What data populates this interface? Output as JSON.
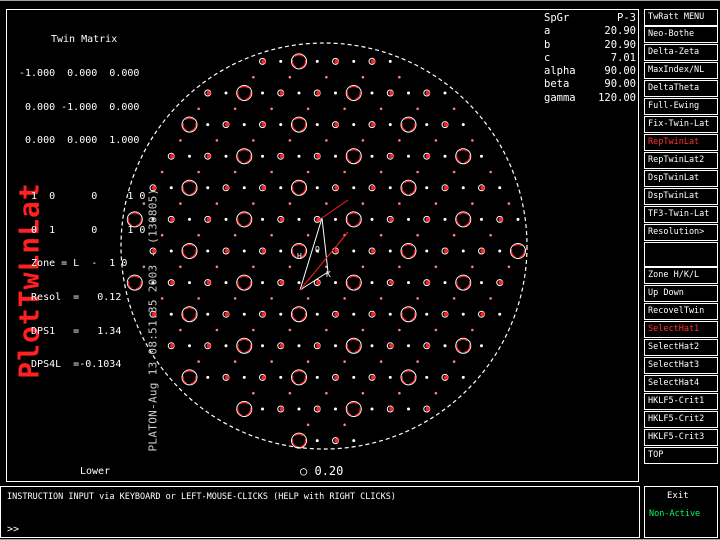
{
  "header": {
    "vertical_title": "PLATON-Aug 13 08:51:35 2003 - (130805)",
    "program_name": "PlotTwLnLat"
  },
  "twin_matrix": {
    "title": "Twin Matrix",
    "rows": [
      "-1.000  0.000  0.000",
      " 0.000 -1.000  0.000",
      " 0.000  0.000  1.000",
      "",
      "  1  0      0     1 0",
      "  0  1      0     1 0",
      "  Zone = L  -  1 0",
      "  Resol  =   0.12",
      "  DPS1   =   1.34",
      "  DPS4L  =-0.1034"
    ]
  },
  "cell_params": [
    {
      "label": "SpGr",
      "value": "P-3"
    },
    {
      "label": "a",
      "value": "20.90"
    },
    {
      "label": "b",
      "value": "20.90"
    },
    {
      "label": "c",
      "value": "7.01"
    },
    {
      "label": "alpha",
      "value": "90.00"
    },
    {
      "label": "beta",
      "value": "90.00"
    },
    {
      "label": "gamma",
      "value": "120.00"
    }
  ],
  "plot": {
    "lower_label": "Lower",
    "scale_label": "0.20",
    "axis_h": "H",
    "axis_k": "K",
    "axis_q": "Q"
  },
  "menu": {
    "items": [
      {
        "label": "TwRatt MENU",
        "color": "white"
      },
      {
        "label": "Neo-Bothe",
        "color": "white"
      },
      {
        "label": "Delta-Zeta",
        "color": "white"
      },
      {
        "label": "MaxIndex/NL",
        "color": "white"
      },
      {
        "label": "DeltaTheta",
        "color": "white"
      },
      {
        "label": "Full-Ewing",
        "color": "white"
      },
      {
        "label": "Fix-Twin-Lat",
        "color": "white"
      },
      {
        "label": "RepTwinLat",
        "color": "red"
      },
      {
        "label": "RepTwinLat2",
        "color": "white"
      },
      {
        "label": "DspTwinLat",
        "color": "white"
      },
      {
        "label": "DspTwinLat",
        "color": "white"
      },
      {
        "label": "TF3-Twin-Lat",
        "color": "white"
      },
      {
        "label": "Resolution>",
        "color": "white"
      },
      {
        "label": "Zone H/K/L",
        "color": "white"
      },
      {
        "label": "Up    Down",
        "color": "white"
      },
      {
        "label": "RecovelTwin",
        "color": "white"
      },
      {
        "label": "SelectHat1",
        "color": "red"
      },
      {
        "label": "SelectHat2",
        "color": "white"
      },
      {
        "label": "SelectHat3",
        "color": "white"
      },
      {
        "label": "SelectHat4",
        "color": "white"
      },
      {
        "label": "HKLF5-Crit1",
        "color": "white"
      },
      {
        "label": "HKLF5-Crit2",
        "color": "white"
      },
      {
        "label": "HKLF5-Crit3",
        "color": "white"
      },
      {
        "label": "TOP",
        "color": "white"
      }
    ],
    "exit_label": "Exit",
    "non_active_label": "Non-Active"
  },
  "instruction": {
    "text": "INSTRUCTION INPUT via KEYBOARD or LEFT-MOUSE-CLICKS (HELP with RIGHT CLICKS)",
    "prompt": ">>"
  },
  "colors": {
    "background": "#000000",
    "foreground": "#ffffff",
    "accent_red": "#ff2020",
    "status_green": "#00ff60"
  }
}
